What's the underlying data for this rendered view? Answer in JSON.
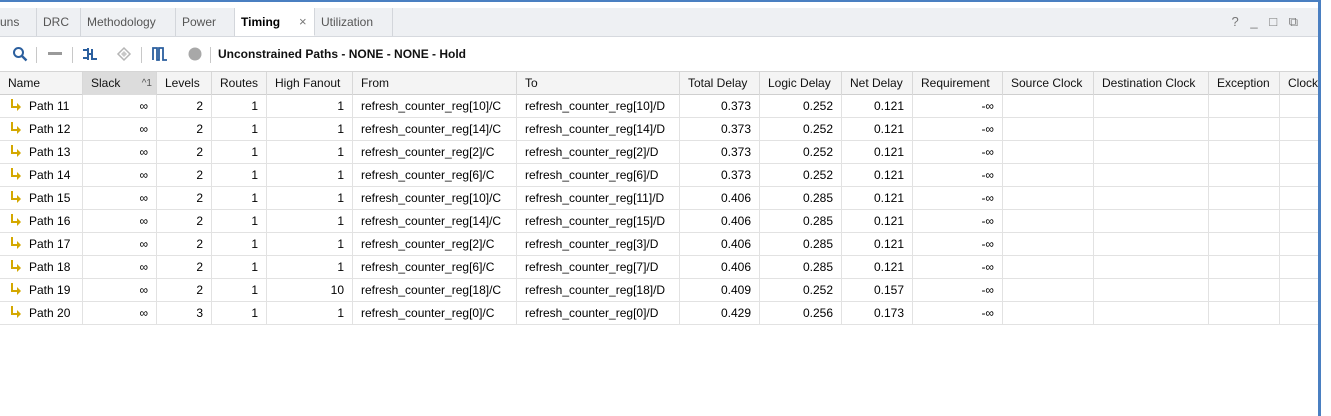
{
  "tabs": [
    {
      "label": "uns",
      "active": false
    },
    {
      "label": "DRC",
      "active": false
    },
    {
      "label": "Methodology",
      "active": false
    },
    {
      "label": "Power",
      "active": false
    },
    {
      "label": "Timing",
      "active": true
    },
    {
      "label": "Utilization",
      "active": false
    }
  ],
  "tab_close_glyph": "×",
  "window_controls": {
    "help": "?",
    "minimize": "_",
    "maximize": "□",
    "restore": "⧉"
  },
  "toolbar": {
    "title": "Unconstrained Paths - NONE - NONE - Hold",
    "icons": [
      "search-icon",
      "collapse-icon",
      "schematic-icon",
      "highlight-icon",
      "waveform-icon",
      "status-dot-icon"
    ]
  },
  "table": {
    "columns": [
      "Name",
      "Slack",
      "Levels",
      "Routes",
      "High Fanout",
      "From",
      "To",
      "Total Delay",
      "Logic Delay",
      "Net Delay",
      "Requirement",
      "Source Clock",
      "Destination Clock",
      "Exception",
      "Clock"
    ],
    "sort_indicator": "^1",
    "rows": [
      {
        "name": "Path 11",
        "slack": "∞",
        "levels": "2",
        "routes": "1",
        "fanout": "1",
        "from": "refresh_counter_reg[10]/C",
        "to": "refresh_counter_reg[10]/D",
        "total": "0.373",
        "logic": "0.252",
        "net": "0.121",
        "req": "-∞"
      },
      {
        "name": "Path 12",
        "slack": "∞",
        "levels": "2",
        "routes": "1",
        "fanout": "1",
        "from": "refresh_counter_reg[14]/C",
        "to": "refresh_counter_reg[14]/D",
        "total": "0.373",
        "logic": "0.252",
        "net": "0.121",
        "req": "-∞"
      },
      {
        "name": "Path 13",
        "slack": "∞",
        "levels": "2",
        "routes": "1",
        "fanout": "1",
        "from": "refresh_counter_reg[2]/C",
        "to": "refresh_counter_reg[2]/D",
        "total": "0.373",
        "logic": "0.252",
        "net": "0.121",
        "req": "-∞"
      },
      {
        "name": "Path 14",
        "slack": "∞",
        "levels": "2",
        "routes": "1",
        "fanout": "1",
        "from": "refresh_counter_reg[6]/C",
        "to": "refresh_counter_reg[6]/D",
        "total": "0.373",
        "logic": "0.252",
        "net": "0.121",
        "req": "-∞"
      },
      {
        "name": "Path 15",
        "slack": "∞",
        "levels": "2",
        "routes": "1",
        "fanout": "1",
        "from": "refresh_counter_reg[10]/C",
        "to": "refresh_counter_reg[11]/D",
        "total": "0.406",
        "logic": "0.285",
        "net": "0.121",
        "req": "-∞"
      },
      {
        "name": "Path 16",
        "slack": "∞",
        "levels": "2",
        "routes": "1",
        "fanout": "1",
        "from": "refresh_counter_reg[14]/C",
        "to": "refresh_counter_reg[15]/D",
        "total": "0.406",
        "logic": "0.285",
        "net": "0.121",
        "req": "-∞"
      },
      {
        "name": "Path 17",
        "slack": "∞",
        "levels": "2",
        "routes": "1",
        "fanout": "1",
        "from": "refresh_counter_reg[2]/C",
        "to": "refresh_counter_reg[3]/D",
        "total": "0.406",
        "logic": "0.285",
        "net": "0.121",
        "req": "-∞"
      },
      {
        "name": "Path 18",
        "slack": "∞",
        "levels": "2",
        "routes": "1",
        "fanout": "1",
        "from": "refresh_counter_reg[6]/C",
        "to": "refresh_counter_reg[7]/D",
        "total": "0.406",
        "logic": "0.285",
        "net": "0.121",
        "req": "-∞"
      },
      {
        "name": "Path 19",
        "slack": "∞",
        "levels": "2",
        "routes": "1",
        "fanout": "10",
        "from": "refresh_counter_reg[18]/C",
        "to": "refresh_counter_reg[18]/D",
        "total": "0.409",
        "logic": "0.252",
        "net": "0.157",
        "req": "-∞"
      },
      {
        "name": "Path 20",
        "slack": "∞",
        "levels": "3",
        "routes": "1",
        "fanout": "1",
        "from": "refresh_counter_reg[0]/C",
        "to": "refresh_counter_reg[0]/D",
        "total": "0.429",
        "logic": "0.256",
        "net": "0.173",
        "req": "-∞"
      }
    ]
  },
  "colors": {
    "accent": "#4a7fc1",
    "path_icon": "#d4a800",
    "tab_bar": "#eef0f3"
  }
}
